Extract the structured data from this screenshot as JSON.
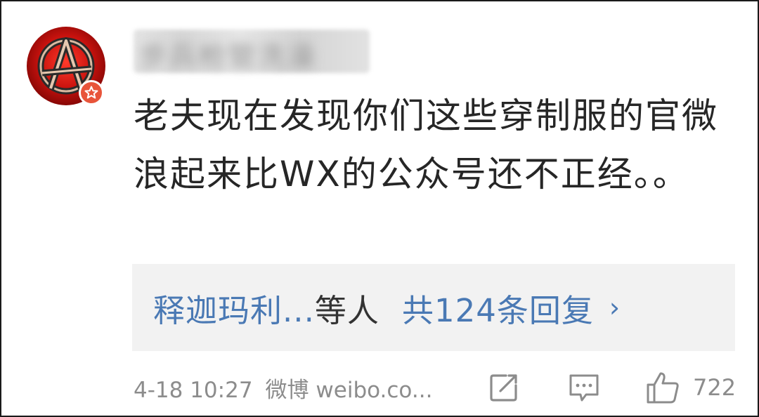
{
  "post": {
    "username": "步兵枪管洗澡",
    "comment_text": "老夫现在发现你们这些穿制服的官微浪起来比WX的公众号还不正经。。",
    "replies": {
      "names": "释迦玛利...",
      "names_suffix": "等人",
      "total": "共124条回复",
      "chevron": "›"
    },
    "meta": {
      "timestamp": "4-18 10:27",
      "source": "微博 weibo.co..."
    },
    "actions": {
      "like_count": "722",
      "share_icon": "share-icon",
      "comment_icon": "comment-icon",
      "like_icon": "thumbs-up-icon"
    },
    "colors": {
      "link": "#4a79b4",
      "meta_gray": "#8c8c8c",
      "badge": "#e8543a",
      "avatar_red": "#c8120e"
    }
  }
}
